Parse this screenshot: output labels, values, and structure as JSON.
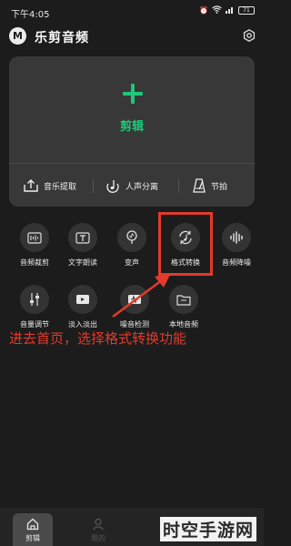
{
  "status": {
    "time": "下午4:05",
    "battery": "71"
  },
  "app": {
    "title": "乐剪音频",
    "logo_letter": "M"
  },
  "card": {
    "edit_label": "剪辑",
    "subs": [
      {
        "label": "音乐提取",
        "icon": "upload-icon"
      },
      {
        "label": "人声分离",
        "icon": "note-icon"
      },
      {
        "label": "节拍",
        "icon": "metronome-icon"
      }
    ]
  },
  "tools": [
    {
      "label": "音频裁剪",
      "icon": "crop-audio-icon"
    },
    {
      "label": "文字朗读",
      "icon": "text-read-icon"
    },
    {
      "label": "变声",
      "icon": "mic-icon"
    },
    {
      "label": "格式转换",
      "icon": "convert-icon"
    },
    {
      "label": "音频降噪",
      "icon": "waveform-icon"
    },
    {
      "label": "音量调节",
      "icon": "volume-slider-icon"
    },
    {
      "label": "淡入淡出",
      "icon": "fade-icon"
    },
    {
      "label": "噪音检测",
      "icon": "noise-detect-icon"
    },
    {
      "label": "本地音频",
      "icon": "folder-icon"
    }
  ],
  "annotation": "进去首页，选择格式转换功能",
  "bottom_nav": {
    "home": "剪辑",
    "mine": "我的"
  },
  "watermark": "时空手游网",
  "colors": {
    "accent": "#1ec77a",
    "annotation": "#e33a2c",
    "background": "#1c1c1c",
    "card": "#383838"
  }
}
